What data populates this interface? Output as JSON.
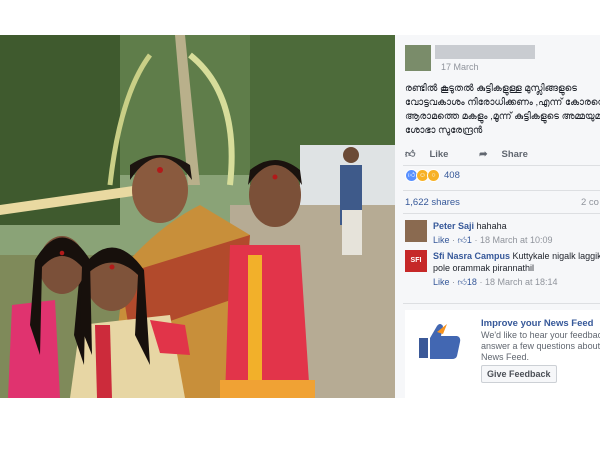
{
  "post": {
    "date": "17 March",
    "text_lines": [
      "രണ്ടിൽ കൂടുതൽ കുട്ടികളുള്ള മുസ്ലിങ്ങളുടെ",
      "വോട്ടവകാശം നിരോധിക്കണം ,എന്ന് കോരന്റെ",
      "ആരാമത്തെ മകളും ,മൂന്ന് കുട്ടികളുടെ അമ്മയുമായ",
      "ശോഭാ സുരേന്ദ്രൻ"
    ],
    "like_label": "Like",
    "share_label": "Share",
    "reaction_count": "408",
    "shares_label": "1,622 shares",
    "comments_label": "2 co"
  },
  "comments": [
    {
      "name": "Peter Saji",
      "text": "hahaha",
      "like": "Like",
      "count": "1",
      "time": "18 March at 10:09"
    },
    {
      "name": "Sfi Nasra Campus",
      "text": "Kuttykale nigalk laggikam",
      "text2": "pole orammak pirannathil",
      "like": "Like",
      "count": "18",
      "time": "18 March at 18:14"
    }
  ],
  "news_feed": {
    "title": "Improve your News Feed",
    "text_lines": [
      "We'd like to hear your feedback! Ple",
      "answer a few questions about you",
      "News Feed."
    ],
    "button": "Give Feedback"
  },
  "colors": {
    "link": "#365899",
    "like_reaction": "#5890ff",
    "haha_reaction": "#f7b125"
  },
  "icons": {
    "like": "thumbs-up-icon",
    "share": "share-arrow-icon"
  }
}
